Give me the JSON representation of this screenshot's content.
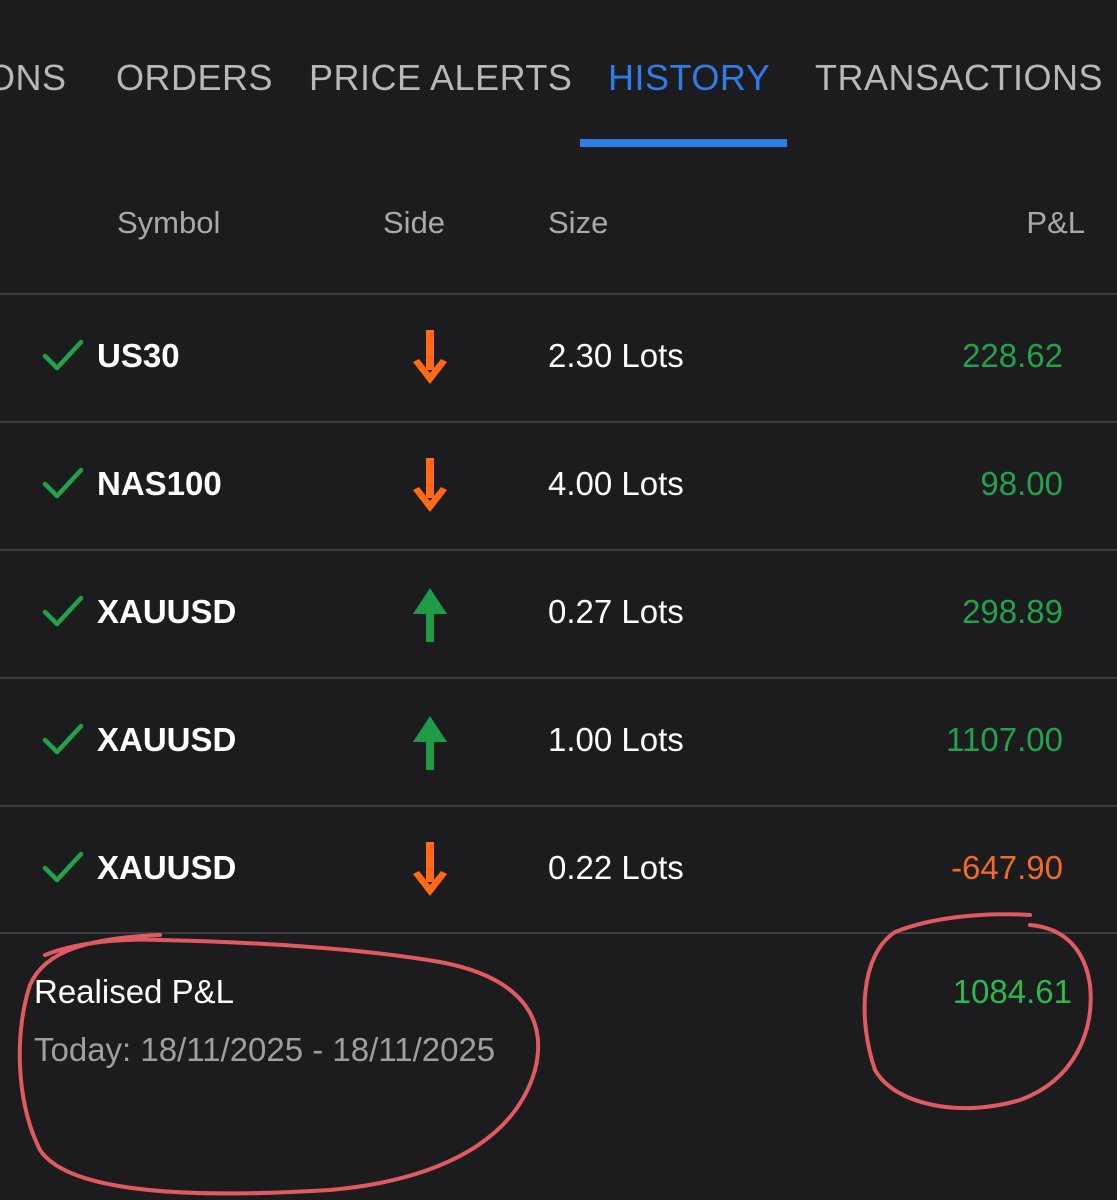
{
  "tabs": [
    {
      "label": "ONS"
    },
    {
      "label": "ORDERS"
    },
    {
      "label": "PRICE ALERTS"
    },
    {
      "label": "HISTORY",
      "active": true
    },
    {
      "label": "TRANSACTIONS"
    }
  ],
  "columns": {
    "symbol": "Symbol",
    "side": "Side",
    "size": "Size",
    "pnl": "P&L"
  },
  "rows": [
    {
      "symbol": "US30",
      "side": "sell",
      "side_icon": "arrow-down-icon",
      "size": "2.30 Lots",
      "pnl": "228.62",
      "pnl_status": "positive"
    },
    {
      "symbol": "NAS100",
      "side": "sell",
      "side_icon": "arrow-down-icon",
      "size": "4.00 Lots",
      "pnl": "98.00",
      "pnl_status": "positive"
    },
    {
      "symbol": "XAUUSD",
      "side": "buy",
      "side_icon": "arrow-up-icon",
      "size": "0.27 Lots",
      "pnl": "298.89",
      "pnl_status": "positive"
    },
    {
      "symbol": "XAUUSD",
      "side": "buy",
      "side_icon": "arrow-up-icon",
      "size": "1.00 Lots",
      "pnl": "1107.00",
      "pnl_status": "positive"
    },
    {
      "symbol": "XAUUSD",
      "side": "sell",
      "side_icon": "arrow-down-icon",
      "size": "0.22 Lots",
      "pnl": "-647.90",
      "pnl_status": "negative"
    }
  ],
  "summary": {
    "label": "Realised P&L",
    "dates": "Today: 18/11/2025 - 18/11/2025",
    "value": "1084.61"
  },
  "colors": {
    "background": "#1c1c1f",
    "accent": "#2f7be8",
    "positive": "#21a34c",
    "negative": "#f06a2a",
    "buy_arrow": "#1f9a45",
    "sell_arrow": "#ff6a13",
    "annotation": "#e05a63"
  }
}
